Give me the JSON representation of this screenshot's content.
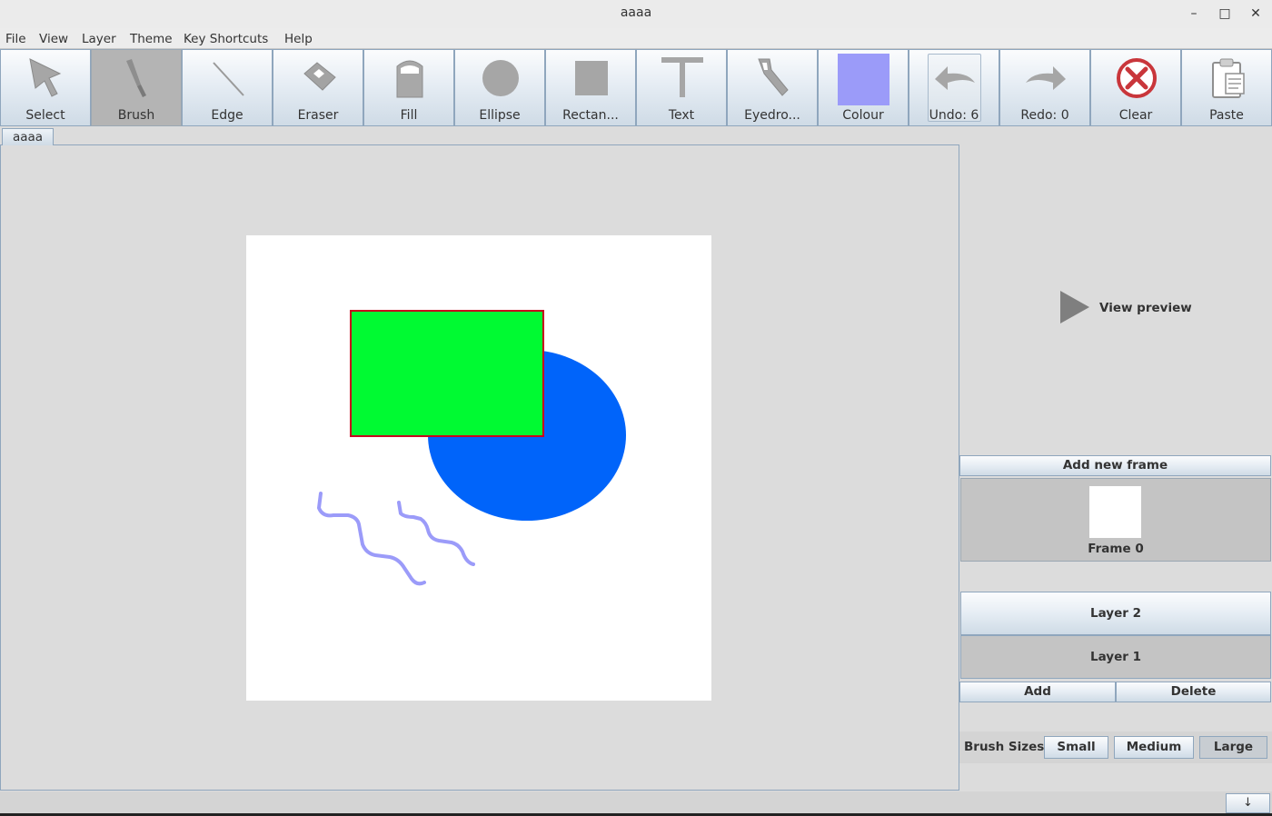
{
  "window": {
    "title": "aaaa",
    "minimize": "–",
    "maximize": "□",
    "close": "✕"
  },
  "menu": [
    "File",
    "View",
    "Layer",
    "Theme",
    "Key Shortcuts",
    "Help"
  ],
  "toolbar": {
    "select": "Select",
    "brush": "Brush",
    "edge": "Edge",
    "eraser": "Eraser",
    "fill": "Fill",
    "ellipse": "Ellipse",
    "rectangle": "Rectan...",
    "text": "Text",
    "eyedropper": "Eyedro...",
    "colour": "Colour",
    "undo": "Undo: 6",
    "redo": "Redo: 0",
    "clear": "Clear",
    "paste": "Paste",
    "selected_tool": "Brush",
    "current_colour": "#9b9bf9"
  },
  "tabs": [
    "aaaa"
  ],
  "canvas": {
    "background": "#ffffff",
    "shapes": [
      {
        "type": "ellipse",
        "fill": "#0064fa"
      },
      {
        "type": "rectangle",
        "fill": "#00fa32",
        "stroke": "#c8001e"
      },
      {
        "type": "brush-stroke",
        "stroke": "#9b9bf9"
      },
      {
        "type": "brush-stroke",
        "stroke": "#9b9bf9"
      }
    ]
  },
  "preview": {
    "label": "View preview",
    "icon": "play-icon"
  },
  "frames": {
    "add_label": "Add new frame",
    "items": [
      {
        "label": "Frame 0"
      }
    ]
  },
  "layers": {
    "items": [
      {
        "label": "Layer 2",
        "active": true
      },
      {
        "label": "Layer 1",
        "active": false
      }
    ],
    "add_label": "Add",
    "delete_label": "Delete"
  },
  "brush_sizes": {
    "label": "Brush Sizes",
    "options": [
      "Small",
      "Medium",
      "Large"
    ],
    "selected": "Medium"
  },
  "status": {
    "scroll_down": "↓"
  }
}
